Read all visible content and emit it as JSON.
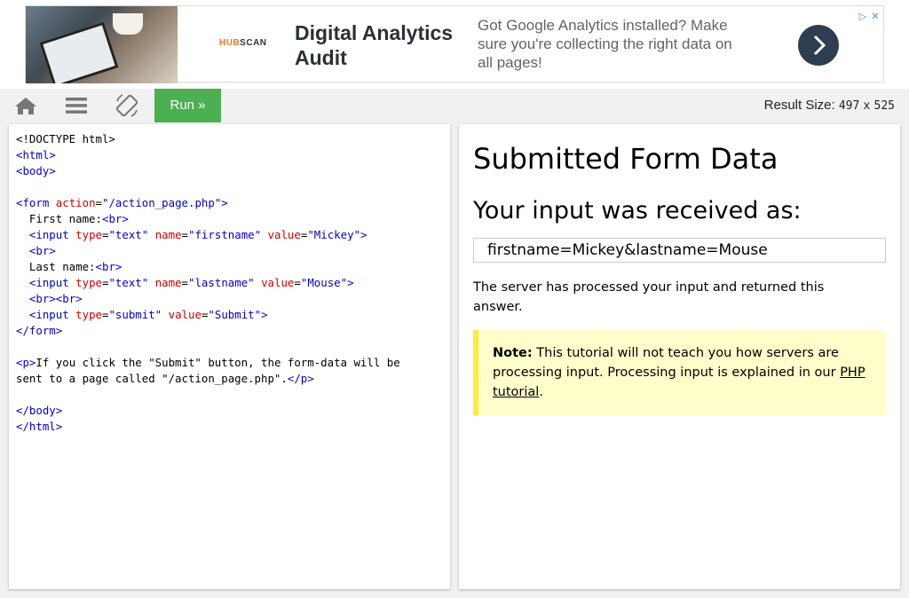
{
  "ad": {
    "logo_prefix": "HUB",
    "logo_suffix": "SCAN",
    "title": "Digital Analytics Audit",
    "text": "Got Google Analytics installed? Make sure you're collecting the right data on all pages!",
    "arrow_icon": "chevron-right-icon",
    "choices_icon": "ad-choices-icon",
    "close_icon": "close-icon"
  },
  "toolbar": {
    "home_icon": "home-icon",
    "menu_icon": "hamburger-menu-icon",
    "rotate_icon": "rotate-device-icon",
    "run_label": "Run »",
    "result_size_label": "Result Size:",
    "result_width": "497",
    "result_x": "x",
    "result_height": "525"
  },
  "code_lines": [
    "<!DOCTYPE html>",
    "<html>",
    "<body>",
    "",
    "<form action=\"/action_page.php\">",
    "  First name:<br>",
    "  <input type=\"text\" name=\"firstname\" value=\"Mickey\">",
    "  <br>",
    "  Last name:<br>",
    "  <input type=\"text\" name=\"lastname\" value=\"Mouse\">",
    "  <br><br>",
    "  <input type=\"submit\" value=\"Submit\">",
    "</form>",
    "",
    "<p>If you click the \"Submit\" button, the form-data will be",
    "sent to a page called \"/action_page.php\".</p>",
    "",
    "</body>",
    "</html>"
  ],
  "result": {
    "title": "Submitted Form Data",
    "subtitle": "Your input was received as:",
    "received_value": "firstname=Mickey&lastname=Mouse",
    "message": "The server has processed your input and returned this answer.",
    "note_label": "Note:",
    "note_text": " This tutorial will not teach you how servers are processing input. Processing input is explained in our ",
    "note_link": "PHP tutorial",
    "note_end": "."
  },
  "colors": {
    "run_button": "#4caf50",
    "note_background": "#ffffcc",
    "note_border": "#ffeb3b",
    "toolbar_background": "#f1f1f1",
    "tag": "#0000cd",
    "attribute": "#cc0000"
  }
}
